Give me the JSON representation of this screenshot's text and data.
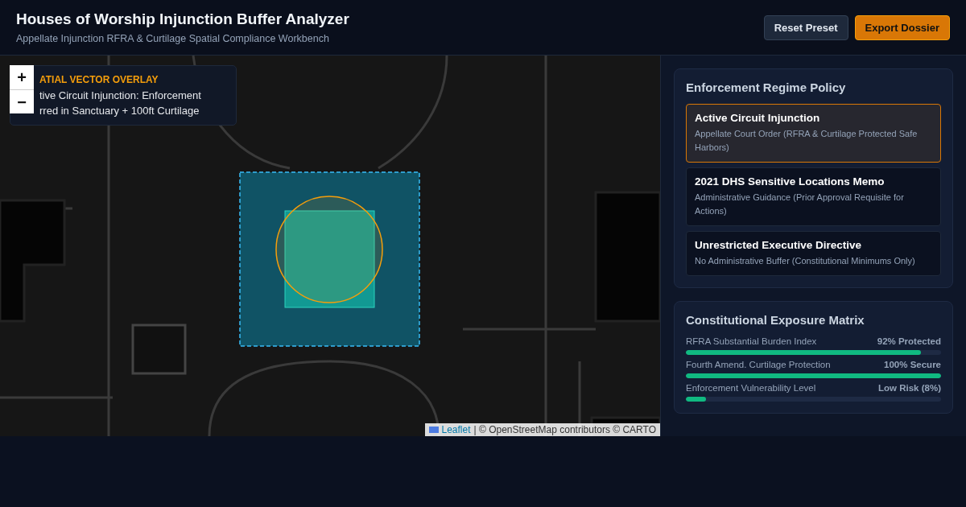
{
  "header": {
    "title": "Houses of Worship Injunction Buffer Analyzer",
    "subtitle": "Appellate Injunction RFRA & Curtilage Spatial Compliance Workbench",
    "buttons": [
      {
        "label": "Reset Preset",
        "kind": "secondary"
      },
      {
        "label": "Export Dossier",
        "kind": "primary"
      }
    ]
  },
  "map": {
    "zoom_in": "+",
    "zoom_out": "−",
    "overlay": {
      "heading": "ATIAL VECTOR OVERLAY",
      "lines": [
        "tive Circuit Injunction: Enforcement",
        "rred in Sanctuary + 100ft Curtilage"
      ]
    },
    "attribution": {
      "link": "Leaflet",
      "text": "| © OpenStreetMap contributors © CARTO"
    }
  },
  "policy": {
    "title": "Enforcement Regime Policy",
    "options": [
      {
        "title": "Active Circuit Injunction",
        "description": "Appellate Court Order (RFRA & Curtilage Protected Safe Harbors)",
        "selected": true
      },
      {
        "title": "2021 DHS Sensitive Locations Memo",
        "description": "Administrative Guidance (Prior Approval Requisite for Actions)",
        "selected": false
      },
      {
        "title": "Unrestricted Executive Directive",
        "description": "No Administrative Buffer (Constitutional Minimums Only)",
        "selected": false
      }
    ]
  },
  "matrix": {
    "title": "Constitutional Exposure Matrix",
    "metrics": [
      {
        "label": "RFRA Substantial Burden Index",
        "reading": "92% Protected",
        "level": 0.92
      },
      {
        "label": "Fourth Amend. Curtilage Protection",
        "reading": "100% Secure",
        "level": 1
      },
      {
        "label": "Enforcement Vulnerability Level",
        "reading": "Low Risk (8%)",
        "level": 0.08
      }
    ]
  }
}
